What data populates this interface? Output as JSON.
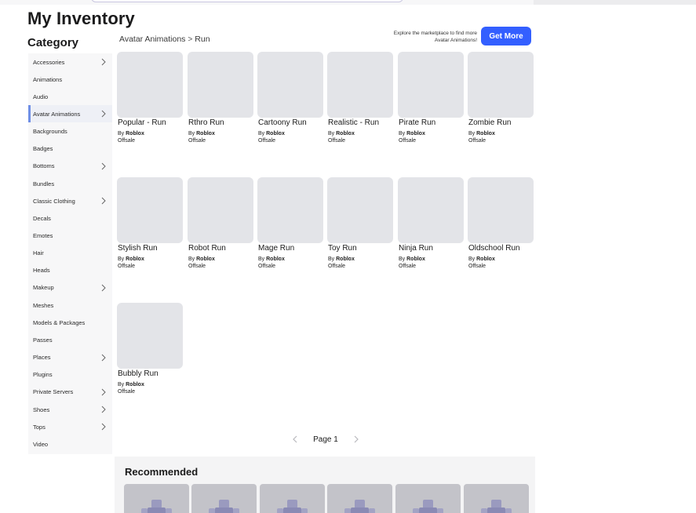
{
  "page": {
    "title": "My Inventory"
  },
  "sidebar": {
    "heading": "Category",
    "items": [
      {
        "label": "Accessories",
        "chevron": true
      },
      {
        "label": "Animations",
        "chevron": false
      },
      {
        "label": "Audio",
        "chevron": false
      },
      {
        "label": "Avatar Animations",
        "chevron": true,
        "active": true
      },
      {
        "label": "Backgrounds",
        "chevron": false
      },
      {
        "label": "Badges",
        "chevron": false
      },
      {
        "label": "Bottoms",
        "chevron": true
      },
      {
        "label": "Bundles",
        "chevron": false
      },
      {
        "label": "Classic Clothing",
        "chevron": true
      },
      {
        "label": "Decals",
        "chevron": false
      },
      {
        "label": "Emotes",
        "chevron": false
      },
      {
        "label": "Hair",
        "chevron": false
      },
      {
        "label": "Heads",
        "chevron": false
      },
      {
        "label": "Makeup",
        "chevron": true
      },
      {
        "label": "Meshes",
        "chevron": false
      },
      {
        "label": "Models & Packages",
        "chevron": false
      },
      {
        "label": "Passes",
        "chevron": false
      },
      {
        "label": "Places",
        "chevron": true
      },
      {
        "label": "Plugins",
        "chevron": false
      },
      {
        "label": "Private Servers",
        "chevron": true
      },
      {
        "label": "Shoes",
        "chevron": true
      },
      {
        "label": "Tops",
        "chevron": true
      },
      {
        "label": "Video",
        "chevron": false
      }
    ]
  },
  "breadcrumb": {
    "parent": "Avatar Animations",
    "separator": ">",
    "current": "Run"
  },
  "promo": {
    "text": "Explore the marketplace to find more Avatar Animations!",
    "button": "Get More"
  },
  "items": [
    {
      "name": "Popular - Run",
      "by_prefix": "By",
      "creator": "Roblox",
      "status": "Offsale"
    },
    {
      "name": "Rthro Run",
      "by_prefix": "By",
      "creator": "Roblox",
      "status": "Offsale"
    },
    {
      "name": "Cartoony Run",
      "by_prefix": "By",
      "creator": "Roblox",
      "status": "Offsale"
    },
    {
      "name": "Realistic - Run",
      "by_prefix": "By",
      "creator": "Roblox",
      "status": "Offsale"
    },
    {
      "name": "Pirate Run",
      "by_prefix": "By",
      "creator": "Roblox",
      "status": "Offsale"
    },
    {
      "name": "Zombie Run",
      "by_prefix": "By",
      "creator": "Roblox",
      "status": "Offsale"
    },
    {
      "name": "Stylish Run",
      "by_prefix": "By",
      "creator": "Roblox",
      "status": "Offsale"
    },
    {
      "name": "Robot Run",
      "by_prefix": "By",
      "creator": "Roblox",
      "status": "Offsale"
    },
    {
      "name": "Mage Run",
      "by_prefix": "By",
      "creator": "Roblox",
      "status": "Offsale"
    },
    {
      "name": "Toy Run",
      "by_prefix": "By",
      "creator": "Roblox",
      "status": "Offsale"
    },
    {
      "name": "Ninja Run",
      "by_prefix": "By",
      "creator": "Roblox",
      "status": "Offsale"
    },
    {
      "name": "Oldschool Run",
      "by_prefix": "By",
      "creator": "Roblox",
      "status": "Offsale"
    },
    {
      "name": "Bubbly Run",
      "by_prefix": "By",
      "creator": "Roblox",
      "status": "Offsale"
    }
  ],
  "pagination": {
    "label": "Page 1",
    "prev_icon": "chevron-left-icon",
    "next_icon": "chevron-right-icon"
  },
  "recommended": {
    "title": "Recommended",
    "card_count": 6
  },
  "colors": {
    "accent": "#335fff",
    "active_indicator": "#6f8fe6",
    "thumb_placeholder": "#e3e4e8",
    "sidebar_bg": "#f7f7f8"
  }
}
